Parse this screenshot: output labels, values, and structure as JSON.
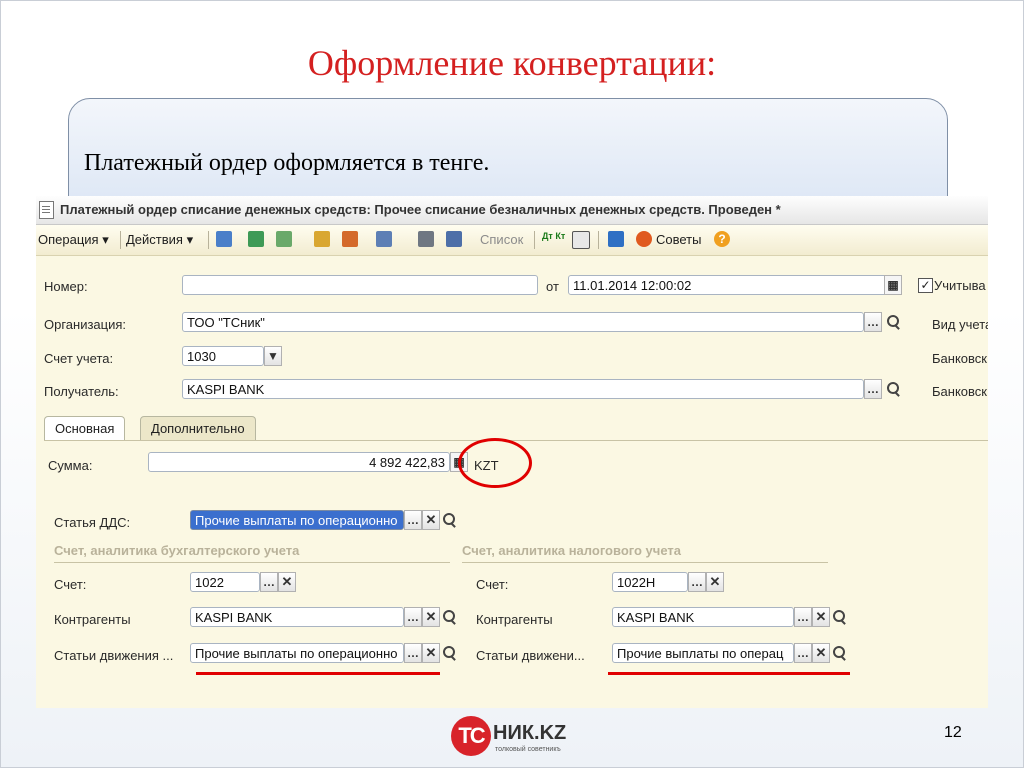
{
  "slide": {
    "title": "Оформление конвертации:",
    "callout_text": "Платежный ордер оформляется в тенге.",
    "page_number": "12",
    "logo": {
      "mark": "ТС",
      "name": "НИК.KZ",
      "tagline": "толковый советникъ"
    }
  },
  "window": {
    "title": "Платежный ордер списание денежных средств: Прочее списание безналичных денежных средств. Проведен *",
    "toolbar": {
      "operation": "Операция ▾",
      "actions": "Действия ▾",
      "list": "Список",
      "dt_kt": "Дт Кт",
      "advice": "Советы"
    },
    "form": {
      "number_label": "Номер:",
      "number_value": "",
      "date_label": "от",
      "date_value": "11.01.2014 12:00:02",
      "consider_label": "Учитыва",
      "org_label": "Организация:",
      "org_value": "ТОО \"ТСник\"",
      "account_label": "Счет учета:",
      "account_value": "1030",
      "recipient_label": "Получатель:",
      "recipient_value": "KASPI BANK",
      "right_label_1": "Вид учета",
      "right_label_2": "Банковск",
      "right_label_3": "Банковск"
    },
    "tabs": [
      {
        "label": "Основная",
        "active": true
      },
      {
        "label": "Дополнительно",
        "active": false
      }
    ],
    "main_tab": {
      "sum_label": "Сумма:",
      "sum_value": "4 892 422,83",
      "currency": "KZT",
      "dds_label": "Статья ДДС:",
      "dds_value": "Прочие выплаты по операционно",
      "acc_section": "Счет, аналитика бухгалтерского учета",
      "tax_section": "Счет, аналитика налогового учета",
      "acc": {
        "account_label": "Счет:",
        "account_value": "1022",
        "counterparty_label": "Контрагенты",
        "counterparty_value": "KASPI BANK",
        "movement_label": "Статьи движения ...",
        "movement_value": "Прочие выплаты по операционно"
      },
      "tax": {
        "account_label": "Счет:",
        "account_value": "1022Н",
        "counterparty_label": "Контрагенты",
        "counterparty_value": "KASPI BANK",
        "movement_label": "Статьи движени...",
        "movement_value": "Прочие выплаты по операц"
      }
    }
  },
  "colors": {
    "title_red": "#d42020",
    "highlight_red": "#e00000",
    "selection_blue": "#3b6fce"
  }
}
